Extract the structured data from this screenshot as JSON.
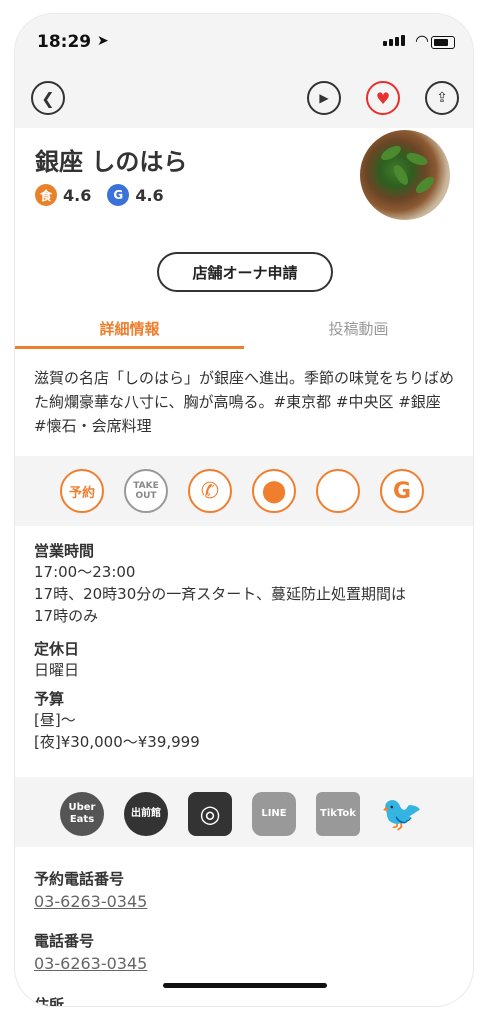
{
  "status": {
    "time": "18:29",
    "location_icon": "location-arrow-icon"
  },
  "nav": {
    "back_icon": "chevron-left-icon",
    "play_icon": "play-plus-icon",
    "favorite_icon": "heart-icon",
    "share_icon": "share-icon"
  },
  "restaurant": {
    "name": "銀座 しのはら",
    "ratings": [
      {
        "badge": "食",
        "value": "4.6",
        "color": "#e8822a"
      },
      {
        "badge": "G",
        "value": "4.6",
        "color": "#3b72d9"
      }
    ]
  },
  "owner_button": "店舗オーナ申請",
  "tabs": [
    {
      "label": "詳細情報",
      "active": true
    },
    {
      "label": "投稿動画",
      "active": false
    }
  ],
  "description": "滋賀の名店「しのはら」が銀座へ進出。季節の味覚をちりばめた絢爛豪華な八寸に、胸が高鳴る。#東京都 #中央区 #銀座 #懐石・会席料理",
  "actions": [
    {
      "label": "予約",
      "icon": "reservation-icon",
      "color": "#ef7f2e"
    },
    {
      "label": "TAKE OUT",
      "icon": "takeout-icon",
      "color": "#999999"
    },
    {
      "label": "",
      "icon": "phone-icon",
      "color": "#ef7f2e"
    },
    {
      "label": "",
      "icon": "map-pin-icon",
      "color": "#ef7f2e"
    },
    {
      "label": "",
      "icon": "empty-circle-icon",
      "color": "#ef7f2e"
    },
    {
      "label": "G",
      "icon": "google-icon",
      "color": "#ef7f2e"
    }
  ],
  "hours": {
    "heading": "営業時間",
    "line1": "17:00〜23:00",
    "line2": "17時、20時30分の一斉スタート、蔓延防止処置期間は",
    "line3": "17時のみ"
  },
  "closed": {
    "heading": "定休日",
    "value": "日曜日"
  },
  "budget": {
    "heading": "予算",
    "lunch": "[昼]〜",
    "dinner": "[夜]¥30,000〜¥39,999"
  },
  "sns": [
    {
      "label": "Uber Eats",
      "icon": "uber-eats-icon"
    },
    {
      "label": "出前館",
      "icon": "demaecan-icon"
    },
    {
      "label": "",
      "icon": "instagram-icon"
    },
    {
      "label": "LINE",
      "icon": "line-icon"
    },
    {
      "label": "TikTok",
      "icon": "tiktok-icon"
    },
    {
      "label": "",
      "icon": "twitter-icon"
    }
  ],
  "reservation_phone": {
    "heading": "予約電話番号",
    "value": "03-6263-0345"
  },
  "phone": {
    "heading": "電話番号",
    "value": "03-6263-0345"
  },
  "address": {
    "heading": "住所"
  }
}
